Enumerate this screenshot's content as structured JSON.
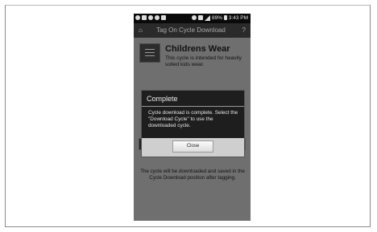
{
  "status_bar": {
    "battery_percent": "89%",
    "time": "3:43 PM"
  },
  "app_bar": {
    "title": "Tag On Cycle Download",
    "help_label": "?"
  },
  "cycle": {
    "name": "Childrens Wear",
    "description": "This cycle is intended for heavily soiled kids wear."
  },
  "dialog": {
    "title": "Complete",
    "message": "Cycle download is complete. Select the \"Download Cycle\" to use the downloaded cycle.",
    "close_label": "Close"
  },
  "footer": {
    "note": "The cycle will be downloaded and saved in the Cycle Download position after tagging."
  },
  "colors": {
    "phone_background": "#6f6f6f",
    "dialog_background": "#1e1e1e",
    "status_bar": "#0a0a0a"
  }
}
